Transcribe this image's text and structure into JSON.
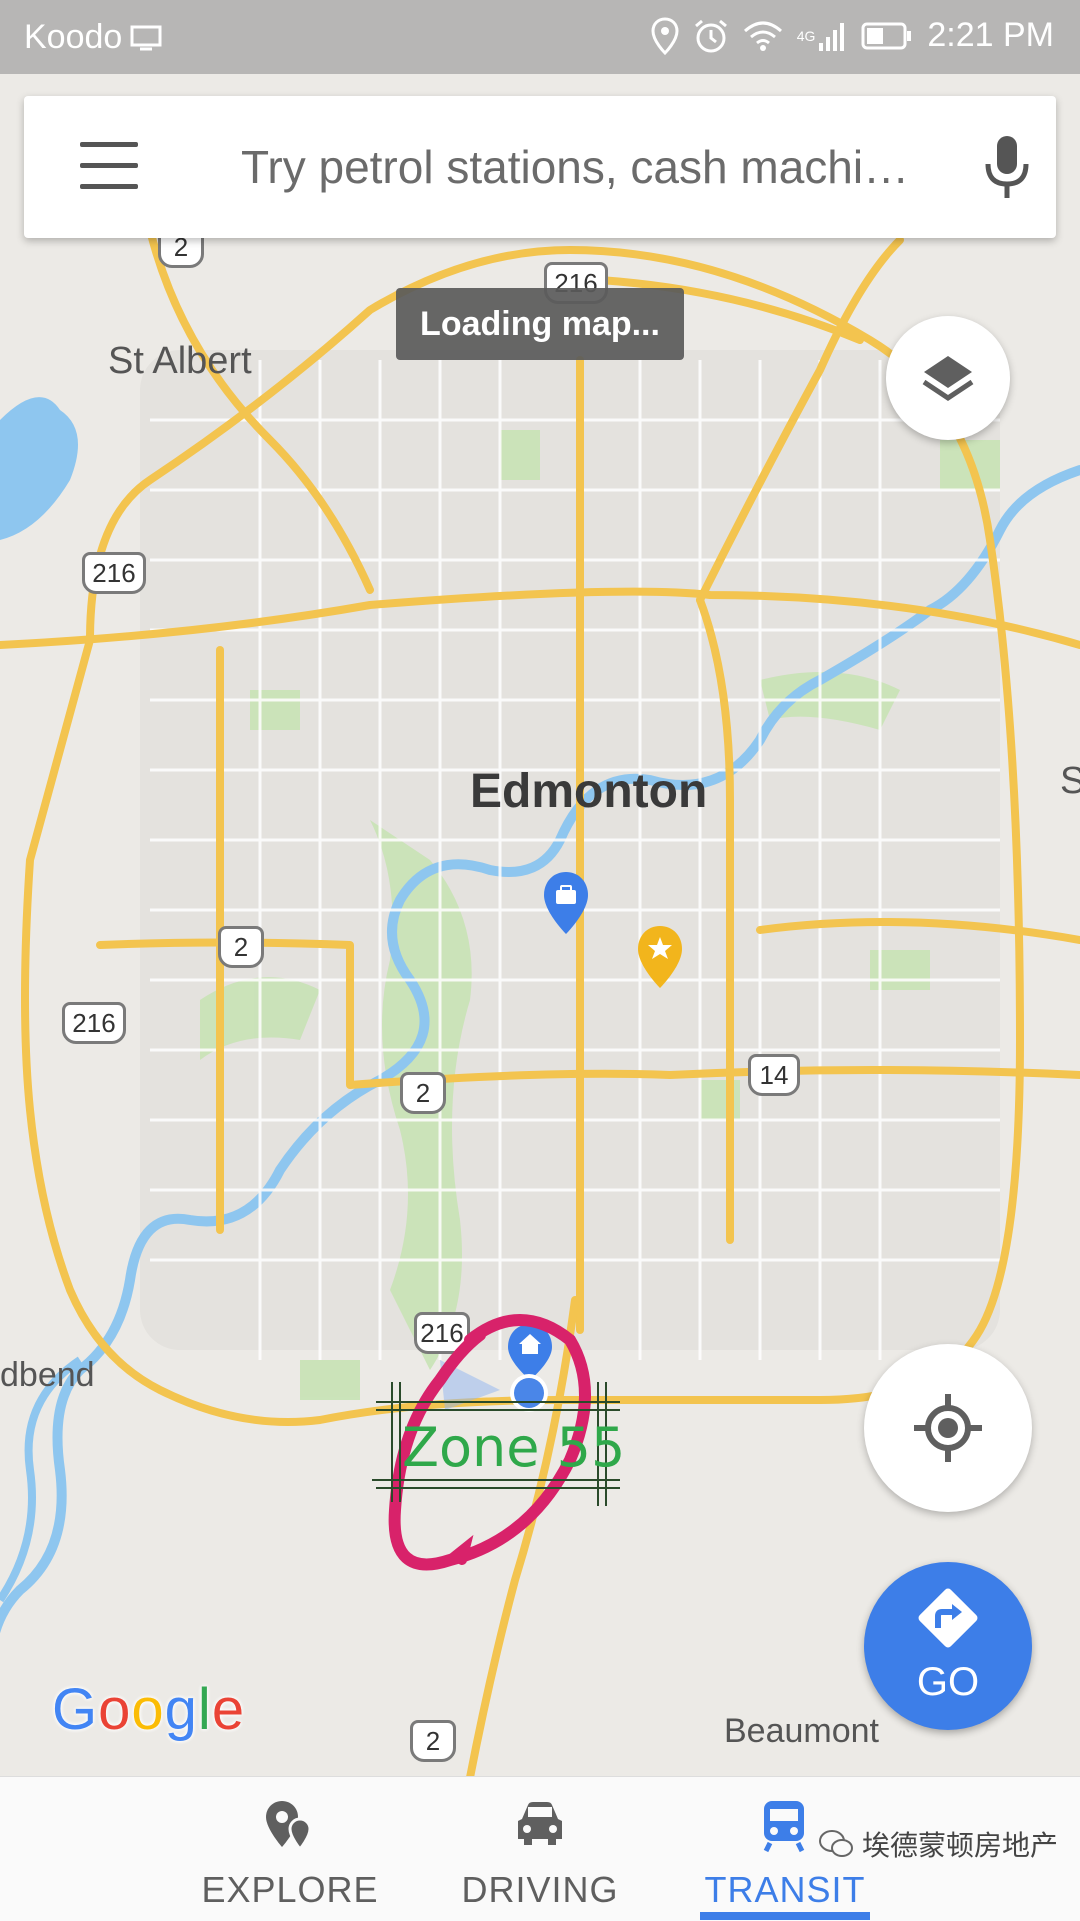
{
  "status_bar": {
    "carrier": "Koodo",
    "time": "2:21 PM",
    "network_badge": "4G",
    "icons": [
      "screen-icon",
      "location-icon",
      "alarm-icon",
      "wifi-icon",
      "signal-icon",
      "battery-icon"
    ]
  },
  "search": {
    "placeholder": "Try petrol stations, cash machi…",
    "menu_icon": "menu-icon",
    "mic_icon": "microphone-icon"
  },
  "map": {
    "loading_text": "Loading map...",
    "labels": {
      "city": "Edmonton",
      "st_albert": "St Albert",
      "beaumont": "Beaumont",
      "dbend": "dbend",
      "edge_s": "S"
    },
    "highway_shields": {
      "h216_top": "216",
      "h2_top": "2",
      "h216_left": "216",
      "h2_mid": "2",
      "h216_lower": "216",
      "h2_center": "2",
      "h14": "14",
      "h216_bottom": "216",
      "h2_bottom": "2"
    },
    "annotation": "Zone 55",
    "attribution": "Google",
    "colors": {
      "land": "#eceae6",
      "road": "#f3c44f",
      "river": "#8ec6ef",
      "park": "#c8e3b5",
      "annotation_circle": "#d8226a",
      "annotation_text": "#2fa84a",
      "accent": "#3d7ee8"
    }
  },
  "controls": {
    "layers_icon": "layers-icon",
    "locate_icon": "my-location-icon",
    "go_label": "GO",
    "go_icon": "directions-icon"
  },
  "bottom_nav": {
    "tabs": [
      {
        "label": "EXPLORE",
        "icon": "explore-pin-icon"
      },
      {
        "label": "DRIVING",
        "icon": "car-icon"
      },
      {
        "label": "TRANSIT",
        "icon": "train-icon",
        "selected": true
      }
    ]
  },
  "watermark": "埃德蒙顿房地产"
}
